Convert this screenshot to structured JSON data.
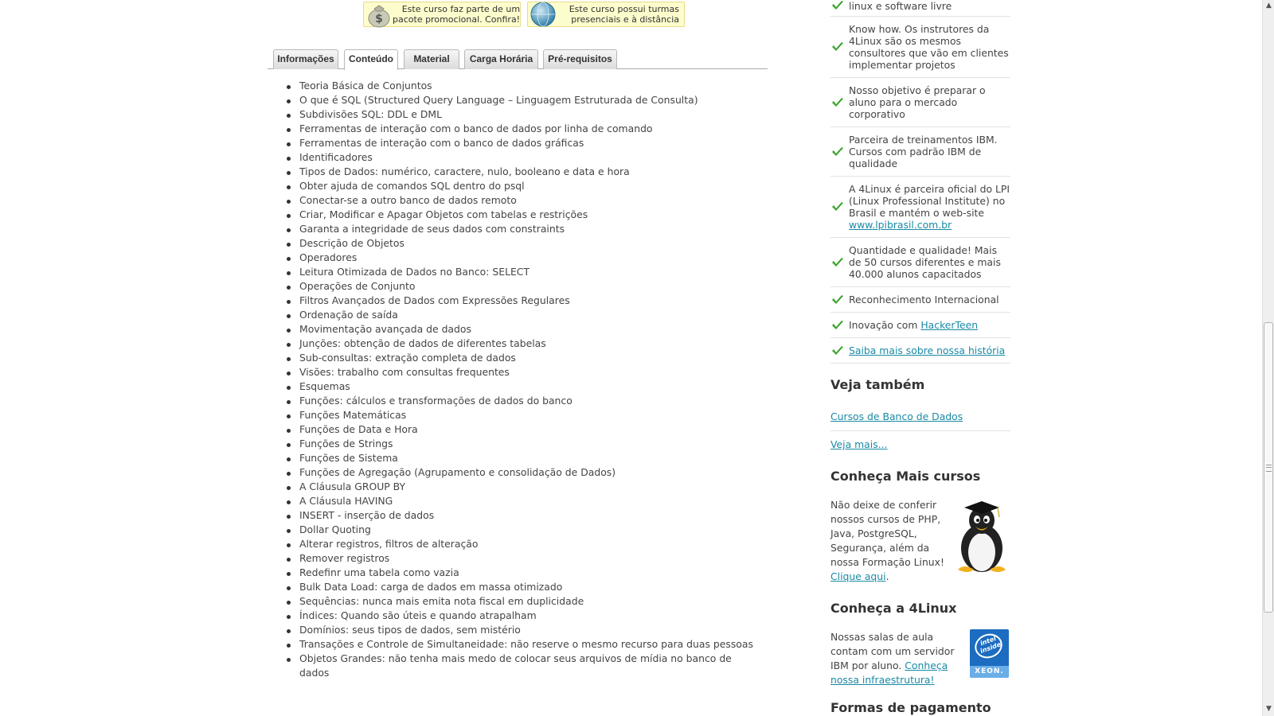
{
  "promos": [
    {
      "line1": "Este curso faz parte de um",
      "line2": "pacote promocional. Confira!",
      "icon": "money-bag-icon"
    },
    {
      "line1": "Este curso possui turmas",
      "line2": "presenciais e à distância",
      "icon": "globe-icon"
    }
  ],
  "tabs": [
    {
      "label": "Informações"
    },
    {
      "label": "Conteúdo",
      "active": true
    },
    {
      "label": "Material"
    },
    {
      "label": "Carga Horária"
    },
    {
      "label": "Pré-requisitos"
    }
  ],
  "content_items": [
    "Teoria Básica de Conjuntos",
    "O que é SQL (Structured Query Language – Linguagem Estruturada de Consulta)",
    "Subdivisões SQL: DDL e DML",
    "Ferramentas de interação com o banco de dados por linha de comando",
    "Ferramentas de interação com o banco de dados gráficas",
    "Identificadores",
    "Tipos de Dados: numérico, caractere, nulo, booleano e data e hora",
    "Obter ajuda de comandos SQL dentro do psql",
    "Conectar-se a outro banco de dados remoto",
    "Criar, Modificar e Apagar Objetos com tabelas e restrições",
    "Garanta a integridade de seus dados com constraints",
    "Descrição de Objetos",
    "Operadores",
    "Leitura Otimizada de Dados no Banco: SELECT",
    "Operações de Conjunto",
    "Filtros Avançados de Dados com Expressões Regulares",
    "Ordenação de saída",
    "Movimentação avançada de dados",
    "Junções: obtenção de dados de diferentes tabelas",
    "Sub-consultas: extração completa de dados",
    "Visões: trabalho com consultas frequentes",
    "Esquemas",
    "Funções: cálculos e transformações de dados do banco",
    "Funções Matemáticas",
    "Funções de Data e Hora",
    "Funções de Strings",
    "Funções de Sistema",
    "Funções de Agregação (Agrupamento e consolidação de Dados)",
    "A Cláusula GROUP BY",
    "A Cláusula HAVING",
    "INSERT - inserção de dados",
    "Dollar Quoting",
    "Alterar registros, filtros de alteração",
    "Remover registros",
    "Redefinr uma tabela como vazia",
    "Bulk Data Load: carga de dados em massa otimizado",
    "Sequências: nunca mais emita nota fiscal em duplicidade",
    "Índices: Quando são úteis e quando atrapalham",
    "Domínios: seus tipos de dados, sem mistério",
    "Transações e Controle de Simultaneidade: não reserve o mesmo recurso para duas pessoas",
    "Objetos Grandes: não tenha mais medo de colocar seus arquivos de mídia no banco de dados"
  ],
  "sidebar": {
    "benefits": [
      {
        "text": "linux e software livre"
      },
      {
        "text": "Know how. Os instrutores da 4Linux são os mesmos consultores que vão em clientes implementar projetos"
      },
      {
        "text": "Nosso objetivo é preparar o aluno para o mercado corporativo"
      },
      {
        "text": "Parceira de treinamentos IBM. Cursos com padrão IBM de qualidade"
      },
      {
        "text": "A 4Linux é parceira oficial do LPI (Linux Professional Institute) no Brasil e mantém o web-site ",
        "link": "www.lpibrasil.com.br"
      },
      {
        "text": "Quantidade e qualidade! Mais de 50 cursos diferentes e mais 40.000 alunos capacitados"
      },
      {
        "text": "Reconhecimento Internacional"
      },
      {
        "text": "Inovação com ",
        "link": "HackerTeen"
      },
      {
        "text": "",
        "link": "Saiba mais sobre nossa história"
      }
    ],
    "see_also_title": "Veja também",
    "see_also_link": "Cursos de Banco de Dados",
    "see_more_link": "Veja mais...",
    "more_courses_title": "Conheça Mais cursos",
    "more_courses_text": "Não deixe de conferir nossos cursos de PHP, Java, PostgreSQL, Segurança, além da nossa Formação Linux!",
    "more_courses_link": "Clique aqui",
    "about_title": "Conheça a 4Linux",
    "about_text": "Nossas salas de aula contam com um servidor IBM por aluno.",
    "about_link": "Conheça nossa infraestrutura!",
    "payment_title": "Formas de pagamento",
    "intel_badge": {
      "top": "intel inside",
      "bottom": "XEON."
    }
  },
  "colors": {
    "link": "#1a8aa5",
    "check": "#3aa52c",
    "promo_bg": "#fdfccc"
  }
}
